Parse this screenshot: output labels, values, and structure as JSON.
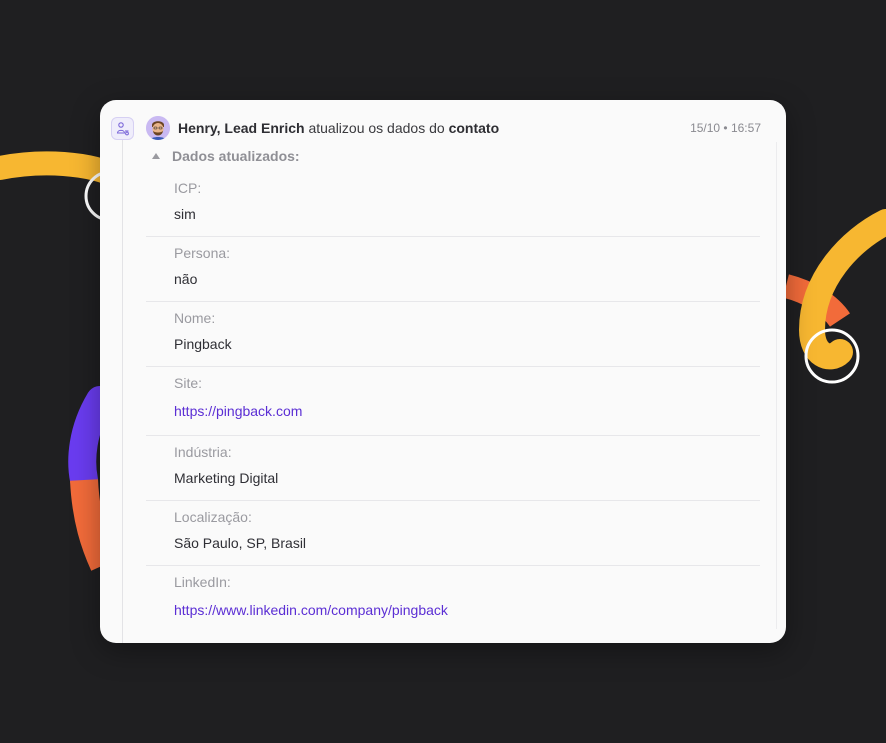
{
  "header": {
    "actor": "Henry, Lead Enrich",
    "action": "atualizou os dados do",
    "object": "contato",
    "timestamp": "15/10 • 16:57"
  },
  "section": {
    "toggle_label": "Dados atualizados:"
  },
  "fields": [
    {
      "label": "ICP:",
      "value": "sim"
    },
    {
      "label": "Persona:",
      "value": "não"
    },
    {
      "label": "Nome:",
      "value": "Pingback"
    },
    {
      "label": "Site:",
      "value": "https://pingback.com"
    },
    {
      "label": "Indústria:",
      "value": "Marketing Digital"
    },
    {
      "label": "Localização:",
      "value": "São Paulo, SP, Brasil"
    },
    {
      "label": "LinkedIn:",
      "value": "https://www.linkedin.com/company/pingback"
    }
  ],
  "icons": {
    "contact": "contact-flow-icon",
    "avatar": "user-avatar",
    "toggle": "caret-up-icon"
  },
  "colors": {
    "background": "#1f1f21",
    "card": "#fafafa",
    "link": "#5b2ed4",
    "accent_yellow": "#f7b731",
    "accent_orange": "#f26b3a",
    "accent_purple": "#6a3cf0"
  }
}
